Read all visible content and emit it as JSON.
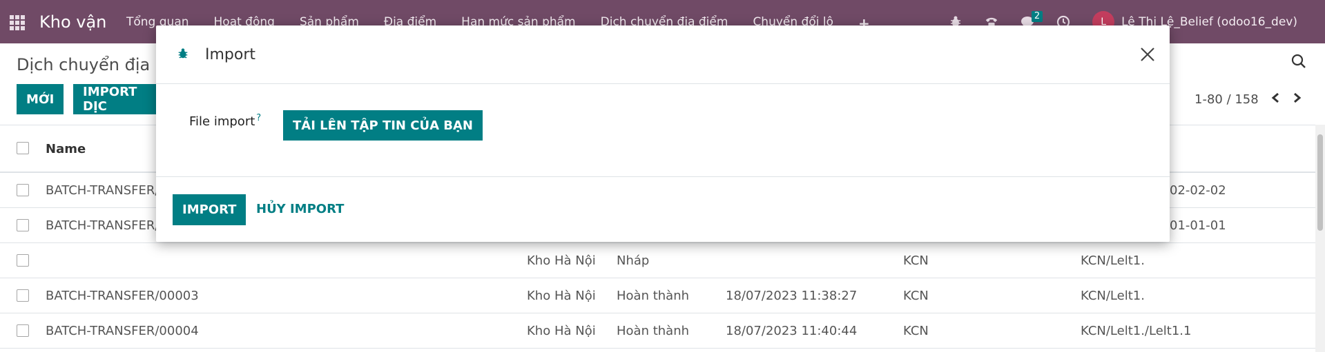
{
  "navbar": {
    "app_name": "Kho vận",
    "menu": [
      "Tổng quan",
      "Hoạt động",
      "Sản phẩm",
      "Địa điểm",
      "Hạn mức sản phẩm",
      "Dịch chuyển địa điểm",
      "Chuyển đổi lô",
      "+"
    ],
    "chat_badge": "2",
    "avatar_initial": "L",
    "user_name": "Lê Thị Lệ_Belief (odoo16_dev)"
  },
  "control_panel": {
    "breadcrumb": "Dịch chuyển địa đ",
    "new_button": "MỚI",
    "import_button": "IMPORT DỊC",
    "pager": "1-80 / 158"
  },
  "list": {
    "header_name": "Name",
    "rows": [
      {
        "name": "BATCH-TRANSFER/",
        "warehouse": "",
        "state": "",
        "date": "",
        "zone": "",
        "location": "02-02-02"
      },
      {
        "name": "BATCH-TRANSFER/",
        "warehouse": "",
        "state": "",
        "date": "",
        "zone": "",
        "location": "01-01-01"
      },
      {
        "name": "",
        "warehouse": "Kho Hà Nội",
        "state": "Nháp",
        "date": "",
        "zone": "KCN",
        "location": "KCN/Lelt1."
      },
      {
        "name": "BATCH-TRANSFER/00003",
        "warehouse": "Kho Hà Nội",
        "state": "Hoàn thành",
        "date": "18/07/2023 11:38:27",
        "zone": "KCN",
        "location": "KCN/Lelt1."
      },
      {
        "name": "BATCH-TRANSFER/00004",
        "warehouse": "Kho Hà Nội",
        "state": "Hoàn thành",
        "date": "18/07/2023 11:40:44",
        "zone": "KCN",
        "location": "KCN/Lelt1./Lelt1.1"
      }
    ]
  },
  "modal": {
    "title": "Import",
    "field_label": "File import",
    "help_mark": "?",
    "upload_button": "TẢI LÊN TẬP TIN CỦA BẠN",
    "import_button": "IMPORT",
    "cancel_button": "HỦY IMPORT"
  },
  "colors": {
    "navbar": "#704a66",
    "primary": "#017e84"
  }
}
